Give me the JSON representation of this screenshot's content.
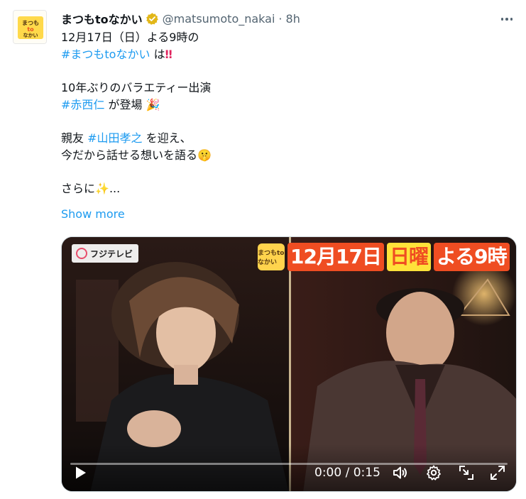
{
  "tweet": {
    "display_name": "まつもtoなかい",
    "handle": "@matsumoto_nakai",
    "separator": "·",
    "time": "8h",
    "avatar_text": "まつもtoなかい",
    "lines": {
      "l1": "12月17日（日）よる9時の",
      "l2_tag": "#まつもtoなかい",
      "l2_rest": " は",
      "l2_emoji": "‼",
      "l3": "10年ぶりのバラエティー出演",
      "l4_tag": "#赤西仁",
      "l4_rest": " が登場 ",
      "l4_emoji": "🎉",
      "l5_pre": "親友 ",
      "l5_tag": "#山田孝之",
      "l5_rest": " を迎え、",
      "l6": "今だから話せる想いを語る",
      "l6_emoji": "🤫",
      "l7": "さらに",
      "l7_emoji": "✨",
      "l7_rest": "..."
    },
    "show_more": "Show more"
  },
  "video": {
    "channel": "フジテレビ",
    "banner_logo": "まつもtoなかい",
    "banner_date": "12月17日",
    "banner_weekday": "日曜",
    "banner_time": "よる9時",
    "time_display": "0:00 / 0:15",
    "progress": 0
  },
  "colors": {
    "link": "#1d9bf0",
    "secondary_text": "#536471",
    "verified_gold": "#e2b719",
    "banner_red": "#ef4d22",
    "banner_yellow": "#ffe23a"
  },
  "icons": [
    "more-icon",
    "verified-icon",
    "play-icon",
    "volume-icon",
    "gear-icon",
    "pip-icon",
    "fullscreen-icon"
  ]
}
